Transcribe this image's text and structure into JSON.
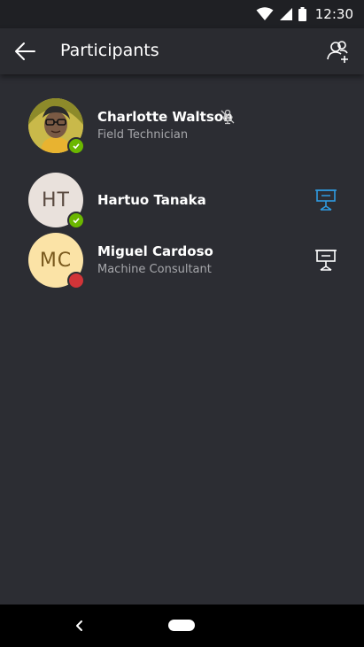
{
  "status_bar": {
    "time": "12:30"
  },
  "app_bar": {
    "title": "Participants"
  },
  "participants": [
    {
      "name": "Charlotte Waltson",
      "role": "Field Technician",
      "initials": "",
      "presence": "available",
      "muted": true,
      "presenting": false
    },
    {
      "name": "Hartuo Tanaka",
      "role": "",
      "initials": "HT",
      "presence": "available",
      "muted": false,
      "presenting": true
    },
    {
      "name": "Miguel Cardoso",
      "role": "Machine Consultant",
      "initials": "MC",
      "presence": "busy",
      "muted": false,
      "presenting": false
    }
  ],
  "colors": {
    "background": "#2c2d33",
    "available": "#6bb700",
    "busy": "#d13438",
    "accent": "#2f9ae0",
    "avatar_ht": "#e9e1dc",
    "avatar_mc": "#fbe3a6"
  }
}
